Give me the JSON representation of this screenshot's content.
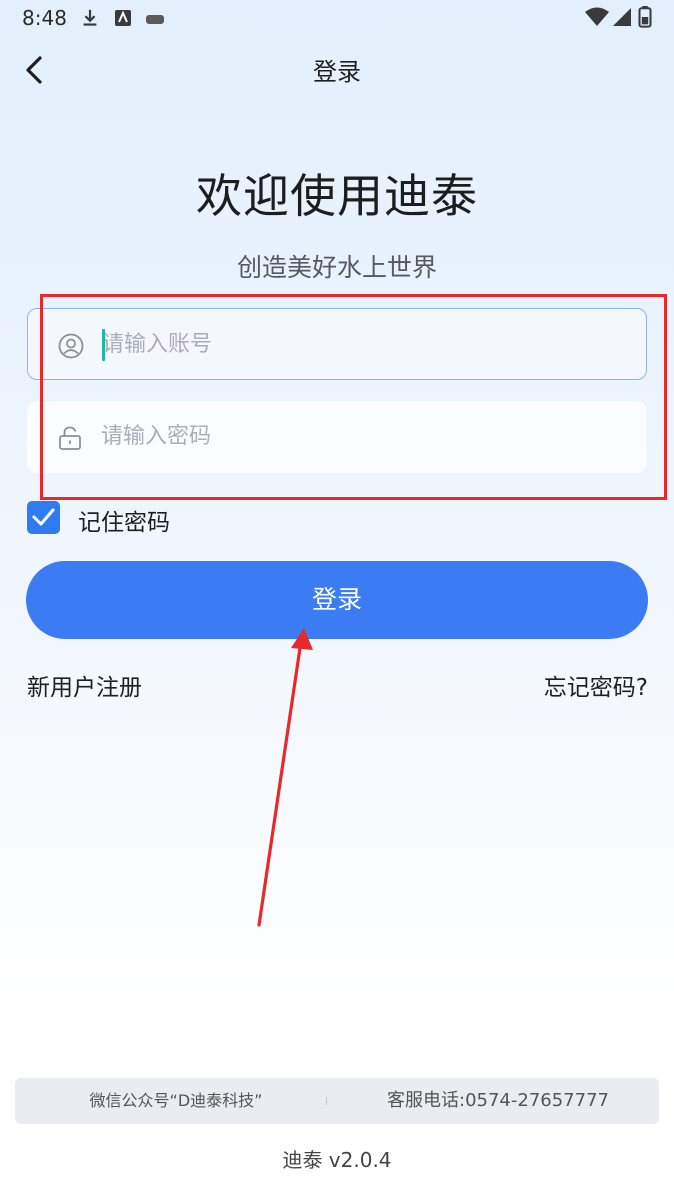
{
  "status_bar": {
    "time": "8:48",
    "icons": [
      "download-icon",
      "app-icon",
      "notification-icon",
      "wifi-icon",
      "signal-icon",
      "battery-icon"
    ]
  },
  "header": {
    "title": "登录",
    "back_icon": "chevron-left-icon"
  },
  "welcome": {
    "title": "欢迎使用迪泰",
    "slogan": "创造美好水上世界"
  },
  "form": {
    "account": {
      "placeholder": "请输入账号",
      "value": "",
      "icon": "user-icon"
    },
    "password": {
      "placeholder": "请输入密码",
      "value": "",
      "icon": "lock-icon"
    },
    "remember": {
      "label": "记住密码",
      "checked": true
    },
    "login_label": "登录"
  },
  "links": {
    "register": "新用户注册",
    "forgot": "忘记密码?"
  },
  "footer": {
    "wechat": "微信公众号“D迪泰科技”",
    "hotline": "客服电话:0574-27657777",
    "version": "迪泰 v2.0.4"
  },
  "colors": {
    "primary": "#3b7cf5",
    "annotation": "#e8282b",
    "caret": "#1fb8a6"
  }
}
